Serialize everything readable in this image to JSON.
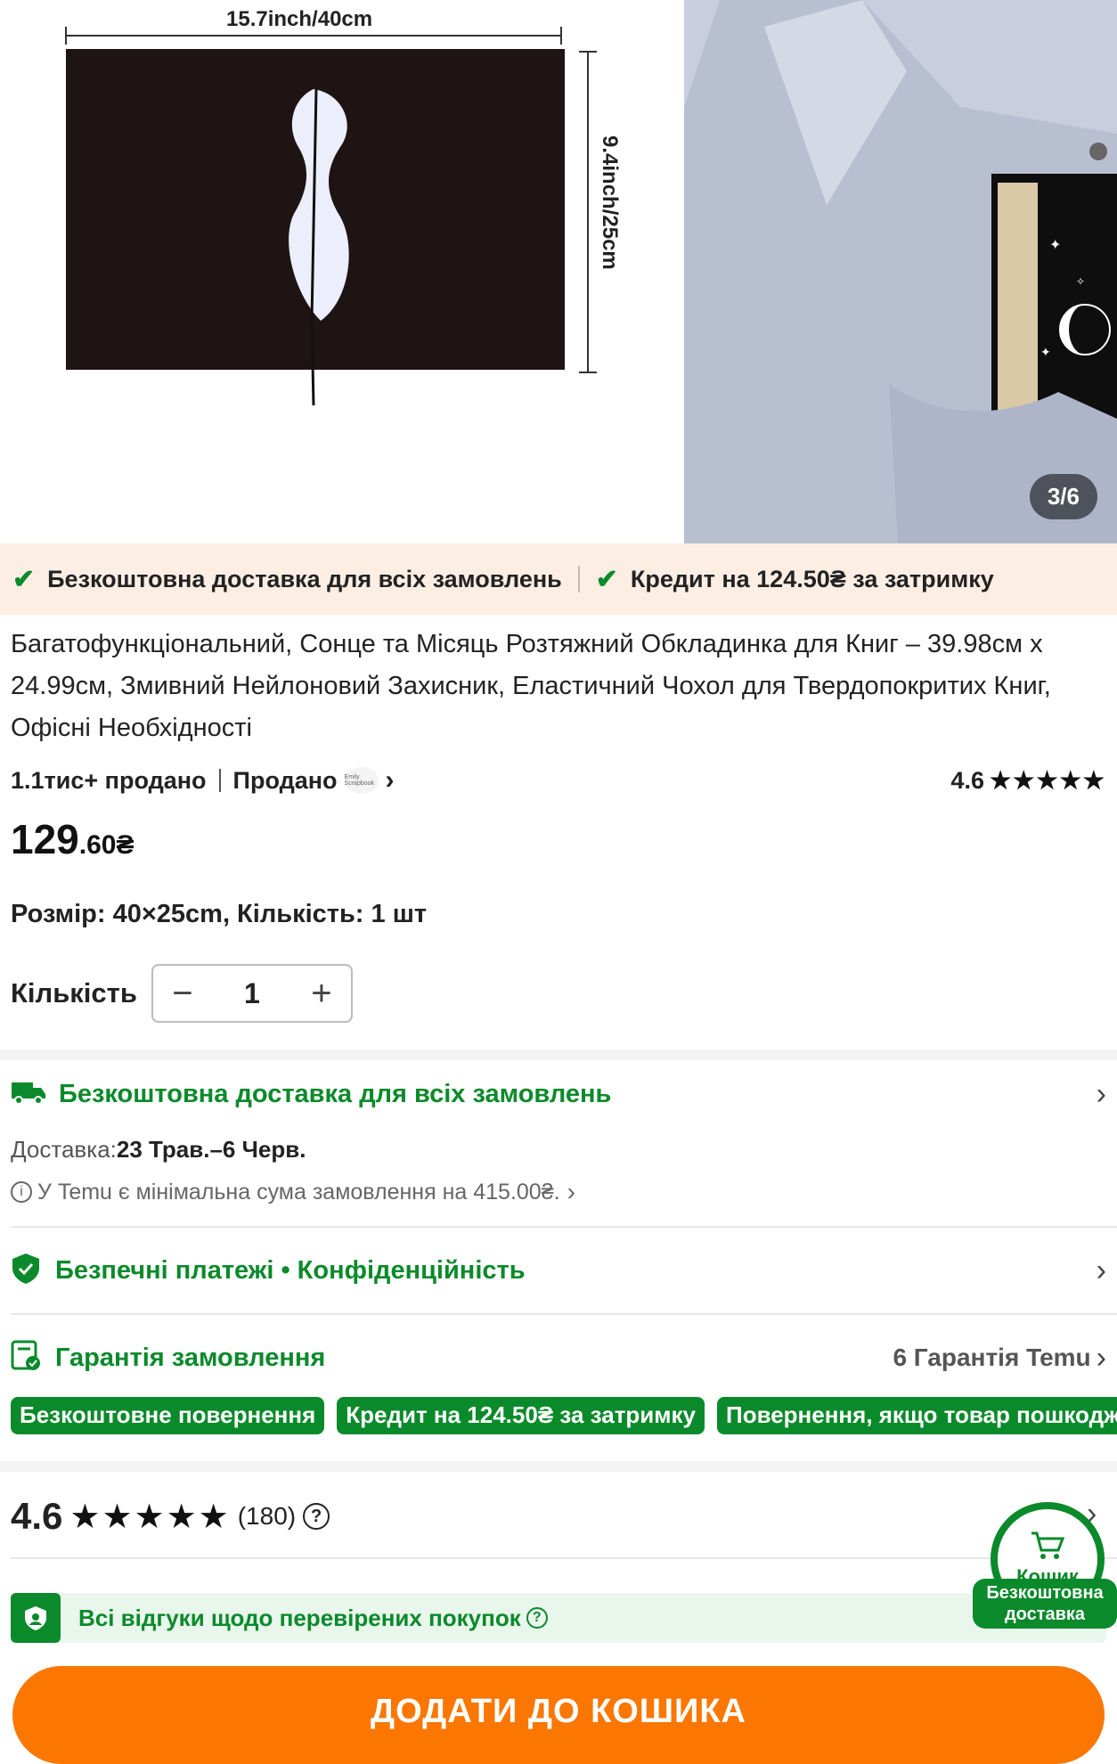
{
  "gallery": {
    "dim_width": "15.7inch/40cm",
    "dim_height": "9.4inch/25cm",
    "counter": "3/6"
  },
  "promo": {
    "item1": "Безкоштовна доставка для всіх замовлень",
    "item2": "Кредит на 124.50₴ за затримку"
  },
  "product": {
    "title": "Багатофункціональний, Сонце та Місяць Розтяжний Обкладинка для Книг – 39.98см x 24.99см, Змивний Нейлоновий Захисник, Еластичний Чохол для Твердопокритих Книг, Офісні Необхідності",
    "sold": "1.1тис+ продано",
    "sold_by": "Продано",
    "seller_logo": "Emily Scrapbook",
    "rating": "4.6",
    "stars": "★★★★★",
    "price_main": "129",
    "price_fraction": ".60₴",
    "variant": "Розмір: 40×25cm, Кількість: 1 шт",
    "qty_label": "Кількість",
    "qty_value": "1"
  },
  "shipping": {
    "title": "Безкоштовна доставка для всіх замовлень",
    "delivery_label": "Доставка:",
    "delivery_dates": "23 Трав.–6 Черв.",
    "min_order": "У Temu є мінімальна сума замовлення на 415.00₴."
  },
  "security": {
    "title": "Безпечні платежі • Конфіденційність"
  },
  "guarantee": {
    "title": "Гарантія замовлення",
    "count": "6 Гарантія Temu",
    "tags": [
      "Безкоштовне повернення",
      "Кредит на 124.50₴ за затримку",
      "Повернення, якщо товар пошкоджено"
    ]
  },
  "reviews": {
    "rating": "4.6",
    "stars": "★★★★★",
    "count": "(180)",
    "verified": "Всі відгуки щодо перевірених покупок"
  },
  "cart": {
    "label": "Кошик",
    "free_shipping": "Безкоштовна доставка",
    "add_button": "ДОДАТИ ДО КОШИКА"
  },
  "colors": {
    "accent_green": "#0a8a2a",
    "orange": "#fb7701",
    "promo_bg": "#fdeee4"
  }
}
